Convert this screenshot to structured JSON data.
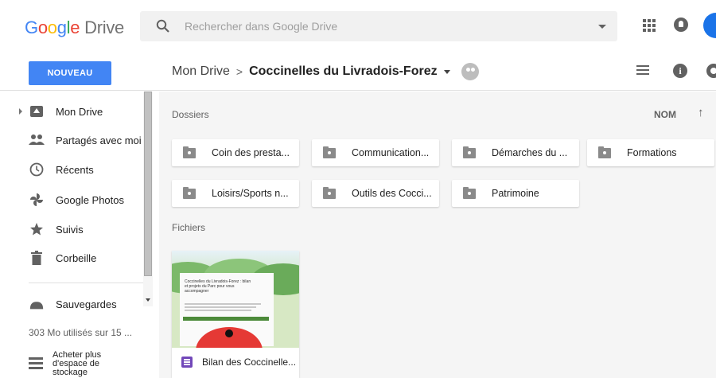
{
  "header": {
    "logo_text": "Google",
    "product": "Drive",
    "search_placeholder": "Rechercher dans Google Drive"
  },
  "toolbar": {
    "new_button": "NOUVEAU",
    "breadcrumb_root": "Mon Drive",
    "breadcrumb_separator": ">",
    "breadcrumb_current": "Coccinelles du Livradois-Forez"
  },
  "sidebar": {
    "items": [
      {
        "label": "Mon Drive",
        "icon": "drive-icon"
      },
      {
        "label": "Partagés avec moi",
        "icon": "shared-icon"
      },
      {
        "label": "Récents",
        "icon": "clock-icon"
      },
      {
        "label": "Google Photos",
        "icon": "photos-icon"
      },
      {
        "label": "Suivis",
        "icon": "star-icon"
      },
      {
        "label": "Corbeille",
        "icon": "trash-icon"
      },
      {
        "label": "Sauvegardes",
        "icon": "cloud-icon"
      }
    ],
    "storage_text": "303 Mo utilisés sur 15 ...",
    "buy_storage": "Acheter plus d'espace de stockage"
  },
  "main": {
    "folders_title": "Dossiers",
    "sort_label": "NOM",
    "sort_arrow": "↑",
    "folders": [
      "Coin des presta...",
      "Communication...",
      "Démarches du ...",
      "Formations",
      "Loisirs/Sports n...",
      "Outils des Cocci...",
      "Patrimoine"
    ],
    "files_title": "Fichiers",
    "files": [
      {
        "name": "Bilan des Coccinelle...",
        "thumb_title": "Coccinelles du Livradois-Forez : bilan et projets du Parc pour vous accompagner"
      }
    ]
  },
  "colors": {
    "accent": "#4285f4",
    "form_icon": "#7248b9"
  }
}
